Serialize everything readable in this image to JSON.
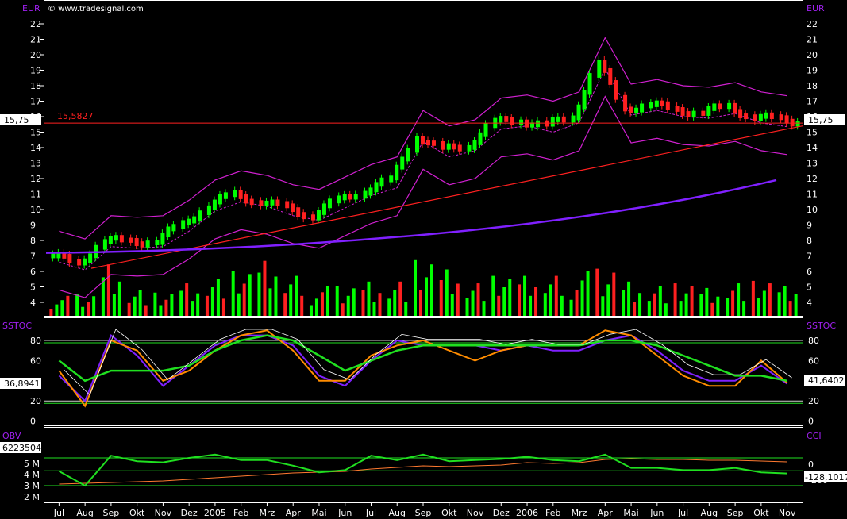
{
  "source_label": "© www.tradesignal.com",
  "currency_left": "EUR",
  "currency_right": "EUR",
  "price_panel": {
    "y_ticks": [
      "22",
      "21",
      "20",
      "19",
      "18",
      "17",
      "16",
      "15",
      "14",
      "13",
      "12",
      "11",
      "10",
      "9",
      "8",
      "7",
      "6",
      "5",
      "4"
    ],
    "last_value_label": "15,75",
    "hline_label": "15,5827"
  },
  "stoch_panel": {
    "title_left": "SSTOC",
    "title_right": "SSTOC",
    "y_ticks": [
      "80",
      "60",
      "40",
      "20",
      "0"
    ],
    "left_value": "36,8941",
    "right_value": "41,6402"
  },
  "obv_panel": {
    "title_left": "OBV",
    "title_right": "CCI",
    "left_value": "6223504",
    "right_value": "-128,1017",
    "left_ticks": [
      "5 M",
      "4 M",
      "3 M",
      "2 M"
    ],
    "right_ticks": [
      "0",
      "-200"
    ]
  },
  "x_axis_labels": [
    "Jul",
    "Aug",
    "Sep",
    "Okt",
    "Nov",
    "Dez",
    "2005",
    "Feb",
    "Mrz",
    "Apr",
    "Mai",
    "Jun",
    "Jul",
    "Aug",
    "Sep",
    "Okt",
    "Nov",
    "Dez",
    "2006",
    "Feb",
    "Mrz",
    "Apr",
    "Mai",
    "Jun",
    "Jul",
    "Aug",
    "Sep",
    "Okt",
    "Nov"
  ],
  "colors": {
    "background": "#000000",
    "axis_text": "#ffffff",
    "axis_title": "#a020f0",
    "up_candle": "#00ff00",
    "down_candle": "#ff2020",
    "bollinger": "#d020d0",
    "ma200": "#8020ff",
    "trendline": "#ff2020",
    "stoch_fast": "#ffffff",
    "stoch_purple": "#8020ff",
    "stoch_orange": "#ff8c00",
    "stoch_green": "#20e020",
    "obv": "#20e020",
    "cci": "#ff7a30"
  },
  "chart_data": [
    {
      "type": "candlestick",
      "panel": "price",
      "y_unit": "EUR",
      "ylim": [
        3.3,
        22.8
      ],
      "hline": 15.5827,
      "last": 15.75,
      "monthly_close": [
        {
          "month": "Jul",
          "value": 7.0
        },
        {
          "month": "Aug",
          "value": 6.5
        },
        {
          "month": "Sep",
          "value": 8.0
        },
        {
          "month": "Okt",
          "value": 7.9
        },
        {
          "month": "Nov",
          "value": 8.0
        },
        {
          "month": "Dez",
          "value": 9.0
        },
        {
          "month": "2005",
          "value": 10.3
        },
        {
          "month": "Feb",
          "value": 10.9
        },
        {
          "month": "Mrz",
          "value": 10.6
        },
        {
          "month": "Apr",
          "value": 10.0
        },
        {
          "month": "Mai",
          "value": 9.7
        },
        {
          "month": "Jun",
          "value": 10.5
        },
        {
          "month": "Jul",
          "value": 11.3
        },
        {
          "month": "Aug",
          "value": 11.8
        },
        {
          "month": "Sep",
          "value": 14.8
        },
        {
          "month": "Okt",
          "value": 13.8
        },
        {
          "month": "Nov",
          "value": 14.2
        },
        {
          "month": "Dez",
          "value": 15.6
        },
        {
          "month": "2006",
          "value": 15.8
        },
        {
          "month": "Feb",
          "value": 15.4
        },
        {
          "month": "Mrz",
          "value": 16.0
        },
        {
          "month": "Apr",
          "value": 19.5
        },
        {
          "month": "Mai",
          "value": 16.5
        },
        {
          "month": "Jun",
          "value": 16.8
        },
        {
          "month": "Jul",
          "value": 16.4
        },
        {
          "month": "Aug",
          "value": 16.3
        },
        {
          "month": "Sep",
          "value": 16.6
        },
        {
          "month": "Okt",
          "value": 16.0
        },
        {
          "month": "Nov",
          "value": 15.75
        }
      ]
    },
    {
      "type": "bar",
      "panel": "volume",
      "note": "relative volume per month, last value in percent of max",
      "values": [
        20,
        25,
        60,
        30,
        25,
        35,
        40,
        45,
        55,
        40,
        30,
        35,
        40,
        40,
        60,
        50,
        35,
        40,
        40,
        40,
        45,
        55,
        40,
        35,
        35,
        30,
        35,
        35,
        30
      ]
    },
    {
      "type": "line",
      "panel": "stochastic",
      "ylim": [
        -5,
        102
      ],
      "series": [
        {
          "values": [
            45,
            20,
            85,
            65,
            35,
            55,
            75,
            85,
            85,
            75,
            45,
            35,
            60,
            80,
            75,
            75,
            75,
            70,
            75,
            70,
            70,
            80,
            85,
            70,
            50,
            40,
            40,
            55,
            37
          ]
        },
        {
          "values": [
            50,
            15,
            80,
            70,
            40,
            50,
            70,
            85,
            90,
            70,
            40,
            40,
            65,
            75,
            80,
            70,
            60,
            70,
            75,
            75,
            75,
            90,
            85,
            65,
            45,
            35,
            35,
            60,
            38
          ]
        },
        {
          "values": [
            60,
            40,
            50,
            50,
            50,
            55,
            70,
            80,
            85,
            80,
            65,
            50,
            60,
            70,
            75,
            75,
            75,
            75,
            75,
            75,
            75,
            80,
            80,
            75,
            65,
            55,
            45,
            45,
            40
          ]
        }
      ],
      "levels": [
        80,
        20
      ]
    },
    {
      "type": "line",
      "panel": "obv_cci",
      "series": [
        {
          "name": "OBV",
          "values": [
            4.3,
            3.0,
            5.7,
            5.2,
            5.1,
            5.5,
            5.8,
            5.3,
            5.3,
            4.8,
            4.2,
            4.4,
            5.7,
            5.3,
            5.8,
            5.2,
            5.3,
            5.4,
            5.6,
            5.3,
            5.2,
            5.8,
            4.6,
            4.6,
            4.4,
            4.4,
            4.6,
            4.2,
            4.1
          ]
        },
        {
          "name": "CCI",
          "values": [
            -250,
            -240,
            -230,
            -220,
            -210,
            -190,
            -170,
            -150,
            -130,
            -110,
            -100,
            -90,
            -60,
            -40,
            -20,
            -30,
            -20,
            -10,
            20,
            10,
            20,
            60,
            70,
            60,
            60,
            50,
            50,
            40,
            30
          ]
        }
      ],
      "levels": [
        0
      ]
    }
  ]
}
